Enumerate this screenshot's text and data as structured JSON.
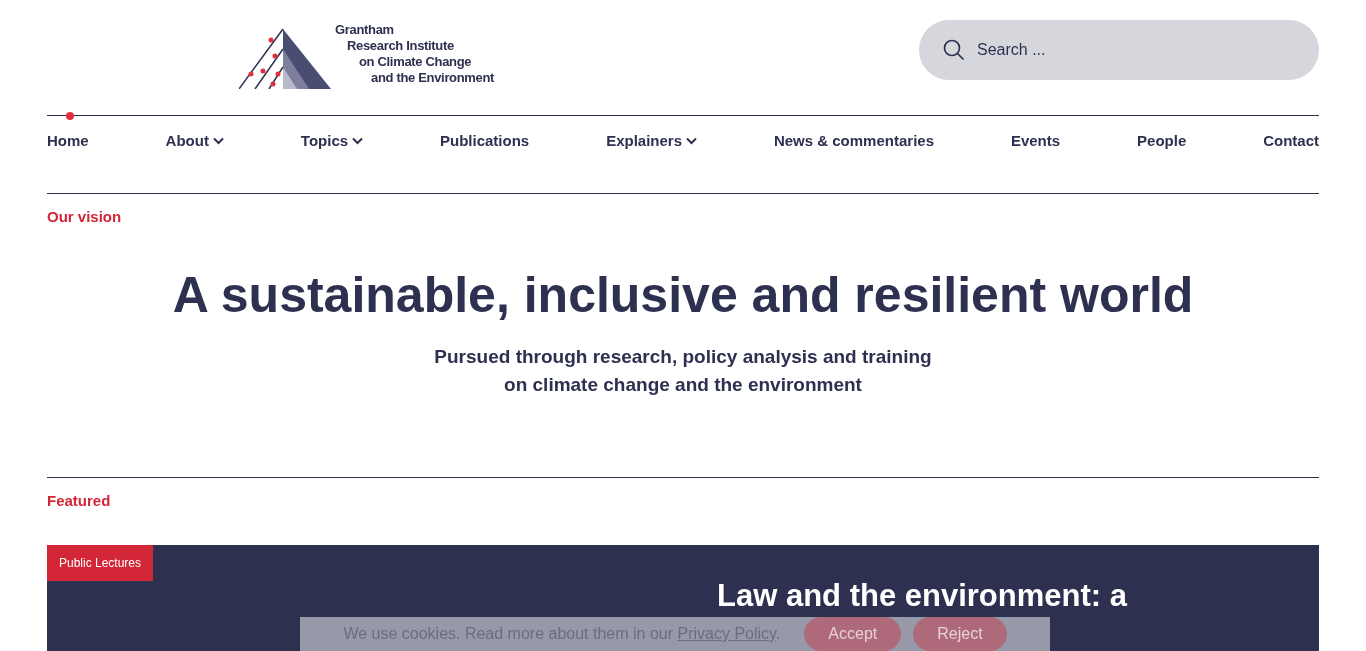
{
  "logo": {
    "lines": [
      "Grantham",
      "Research Institute",
      "on Climate Change",
      "and the Environment"
    ]
  },
  "search": {
    "placeholder": "Search ..."
  },
  "nav": [
    {
      "label": "Home",
      "selected": true,
      "has_menu": false
    },
    {
      "label": "About",
      "selected": false,
      "has_menu": true
    },
    {
      "label": "Topics",
      "selected": false,
      "has_menu": true
    },
    {
      "label": "Publications",
      "selected": false,
      "has_menu": false
    },
    {
      "label": "Explainers",
      "selected": false,
      "has_menu": true
    },
    {
      "label": "News & commentaries",
      "selected": false,
      "has_menu": false
    },
    {
      "label": "Events",
      "selected": false,
      "has_menu": false
    },
    {
      "label": "People",
      "selected": false,
      "has_menu": false
    },
    {
      "label": "Contact",
      "selected": false,
      "has_menu": false
    }
  ],
  "vision": {
    "label": "Our vision",
    "heading": "A sustainable, inclusive and resilient world",
    "subheading": "Pursued through research, policy analysis and training on climate change and the environment"
  },
  "featured": {
    "label": "Featured",
    "tag": "Public Lectures",
    "title": "Law and the environment: a"
  },
  "cookie_banner": {
    "text": "We use cookies. Read more about them in our",
    "link": "Privacy Policy",
    "after_link": ".",
    "buttons": [
      "Accept",
      "Reject"
    ]
  }
}
